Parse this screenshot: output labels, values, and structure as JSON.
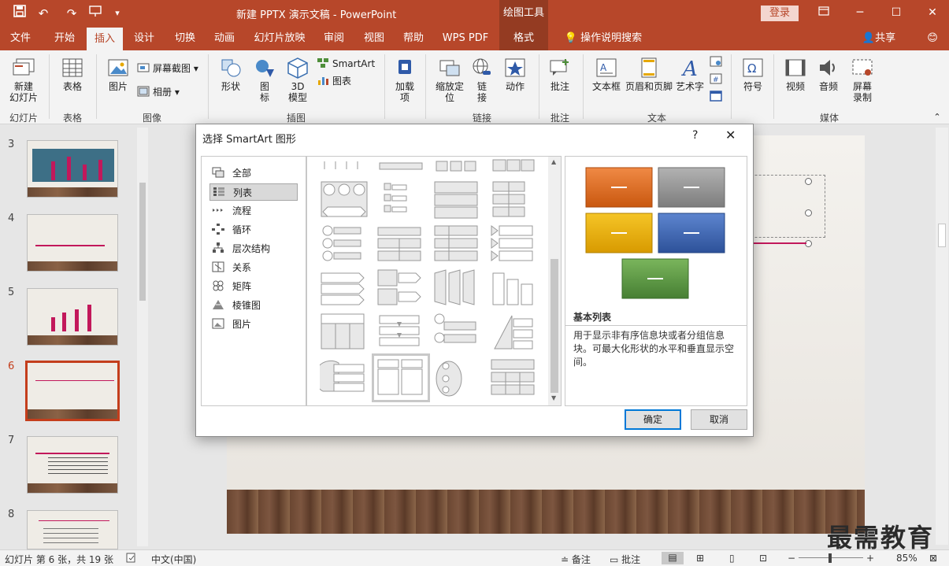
{
  "window": {
    "title": "新建 PPTX 演示文稿  -  PowerPoint",
    "context_tab": "绘图工具",
    "login": "登录"
  },
  "tabs": [
    "文件",
    "开始",
    "插入",
    "设计",
    "切换",
    "动画",
    "幻灯片放映",
    "审阅",
    "视图",
    "帮助",
    "WPS PDF",
    "格式"
  ],
  "tell_me": "操作说明搜索",
  "share": "共享",
  "ribbon": {
    "new_slide": "新建\n幻灯片",
    "table": "表格",
    "picture": "图片",
    "screenshot": "屏幕截图",
    "album": "相册",
    "shapes": "形状",
    "icons": "图\n标",
    "model3d": "3D\n模型",
    "smartart": "SmartArt",
    "chart": "图表",
    "addins": "加载\n项",
    "zoom": "缩放定\n位",
    "link": "链\n接",
    "action": "动作",
    "comment": "批注",
    "textbox": "文本框",
    "headerfooter": "页眉和页脚",
    "wordart": "艺术字",
    "symbol": "符号",
    "video": "视频",
    "audio": "音频",
    "screenrec": "屏幕\n录制",
    "groups": {
      "slides": "幻灯片",
      "tables": "表格",
      "images": "图像",
      "illustrations": "插图",
      "links": "链接",
      "comments": "批注",
      "text": "文本",
      "media": "媒体"
    }
  },
  "thumbnails": [
    {
      "num": "3"
    },
    {
      "num": "4"
    },
    {
      "num": "5"
    },
    {
      "num": "6"
    },
    {
      "num": "7"
    },
    {
      "num": "8"
    }
  ],
  "status": {
    "slide_info": "幻灯片 第 6 张，共 19 张",
    "language": "中文(中国)",
    "notes": "备注",
    "comments": "批注",
    "zoom": "85%"
  },
  "dialog": {
    "title": "选择 SmartArt 图形",
    "help": "?",
    "close": "✕",
    "categories": [
      "全部",
      "列表",
      "流程",
      "循环",
      "层次结构",
      "关系",
      "矩阵",
      "棱锥图",
      "图片"
    ],
    "selected_category": "列表",
    "preview_name": "基本列表",
    "preview_desc": "用于显示非有序信息块或者分组信息块。可最大化形状的水平和垂直显示空间。",
    "ok": "确定",
    "cancel": "取消"
  },
  "colors": {
    "accent": "#b7472a",
    "orange": "#e46c1a",
    "gray": "#8c8c8c",
    "gold": "#e6a800",
    "blue": "#2f5aa8",
    "green": "#4e8e3a"
  },
  "watermark": "最需教育"
}
